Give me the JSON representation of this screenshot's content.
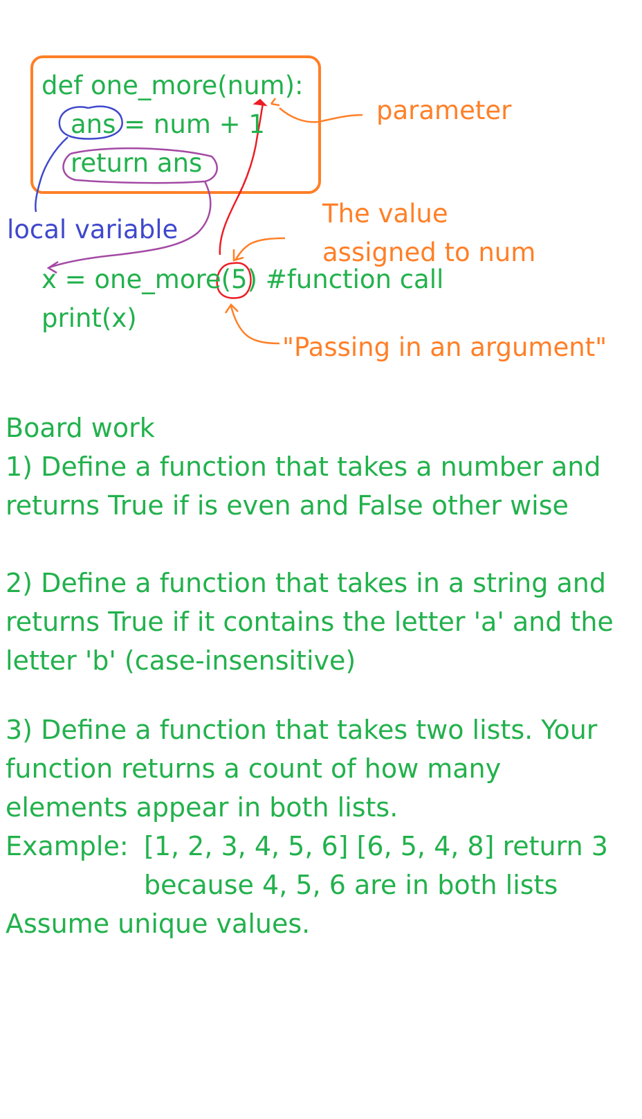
{
  "colors": {
    "code_text": "#22b14c",
    "annotation_orange": "#ff7f27",
    "local_variable_blue": "#3f48cc",
    "return_circle_purple": "#a349a4",
    "argument_red": "#ed1c24",
    "background": "#ffffff"
  },
  "code": {
    "line1": "def one_more(num):",
    "line2": "ans = num + 1",
    "line3": "return ans",
    "line4": "x = one_more(5) #function call",
    "line5": "print(x)"
  },
  "annotations": {
    "parameter": "parameter",
    "value_line1": "The value",
    "value_line2": "assigned to num",
    "argument": "\"Passing in an argument\"",
    "local_variable": "local variable"
  },
  "board": {
    "heading": "Board work",
    "q1_line1": "1) Define a function that takes a number and",
    "q1_line2": "returns True if is even and False other wise",
    "q2_line1": "2) Define a function that takes in a string and",
    "q2_line2": "returns True if it contains the letter 'a' and the",
    "q2_line3": "letter 'b' (case-insensitive)",
    "q3_line1": "3) Define a function that takes two lists. Your",
    "q3_line2": "function returns a count of how many",
    "q3_line3": "elements appear in both lists.",
    "example_label": "Example:",
    "example_line1": "[1, 2, 3, 4, 5, 6] [6, 5, 4, 8] return 3",
    "example_line2": "because 4, 5, 6 are in both lists",
    "assumption": "Assume unique values."
  }
}
